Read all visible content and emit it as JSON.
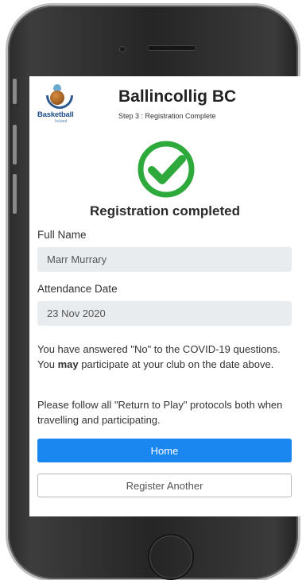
{
  "header": {
    "logo_text": "Basketball",
    "logo_sub": "Ireland",
    "club_name": "Ballincollig BC",
    "step": "Step 3 : Registration Complete"
  },
  "status": {
    "icon": "check-circle-icon",
    "heading": "Registration completed",
    "color": "#2eaa3c"
  },
  "form": {
    "full_name_label": "Full Name",
    "full_name_value": "Marr Murrary",
    "attendance_label": "Attendance Date",
    "attendance_value": "23 Nov 2020"
  },
  "message": {
    "part1": "You have answered \"No\" to the COVID-19 questions. You ",
    "emphasis": "may",
    "part2": " participate at your club on the date above.",
    "protocols": "Please follow all \"Return to Play\" protocols both when travelling and participating."
  },
  "actions": {
    "home_label": "Home",
    "register_another_label": "Register Another"
  },
  "colors": {
    "primary": "#1a86f0",
    "field_bg": "#e9ecef"
  }
}
